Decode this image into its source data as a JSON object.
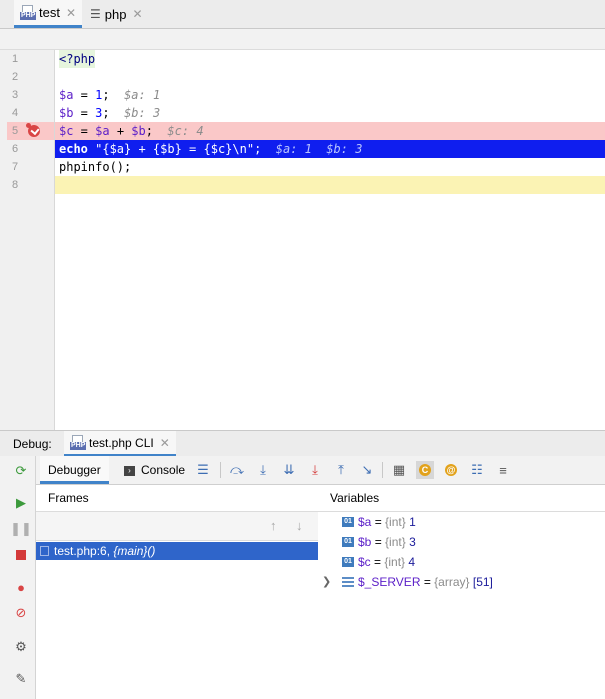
{
  "editor_tabs": [
    {
      "label": "test",
      "active": true
    },
    {
      "label": "php",
      "active": false
    }
  ],
  "code_lines": [
    {
      "n": "1"
    },
    {
      "n": "2"
    },
    {
      "n": "3"
    },
    {
      "n": "4"
    },
    {
      "n": "5"
    },
    {
      "n": "6"
    },
    {
      "n": "7"
    },
    {
      "n": "8"
    }
  ],
  "code": {
    "l1": "<?php",
    "l3_var": "$a",
    "l3_op": " = ",
    "l3_num": "1",
    "l3_semi": ";",
    "l3_hint": "$a: 1",
    "l4_var": "$b",
    "l4_op": " = ",
    "l4_num": "3",
    "l4_semi": ";",
    "l4_hint": "$b: 3",
    "l5_var1": "$c",
    "l5_op1": " = ",
    "l5_var2": "$a",
    "l5_op2": " + ",
    "l5_var3": "$b",
    "l5_semi": ";",
    "l5_hint": "$c: 4",
    "l6_kw": "echo",
    "l6_str": " \"{$a} + {$b} = {$c}\\n\";",
    "l6_hint1": "$a: 1",
    "l6_hint2": "$b: 3",
    "l7": "phpinfo();"
  },
  "debug": {
    "label": "Debug:",
    "session_tab": "test.php CLI",
    "subtabs": {
      "debugger": "Debugger",
      "console": "Console"
    },
    "frames_title": "Frames",
    "frame": {
      "location": "test.php:6, ",
      "function": "{main}()"
    },
    "variables_title": "Variables",
    "variables": [
      {
        "name": "$a",
        "eq": " = ",
        "type": "{int}",
        "value": " 1",
        "icon": "01"
      },
      {
        "name": "$b",
        "eq": " = ",
        "type": "{int}",
        "value": " 3",
        "icon": "01"
      },
      {
        "name": "$c",
        "eq": " = ",
        "type": "{int}",
        "value": " 4",
        "icon": "01"
      },
      {
        "name": "$_SERVER",
        "eq": " = ",
        "type": "{array}",
        "value": " [51]",
        "icon": "array"
      }
    ]
  },
  "colors": {
    "breakpoint_line": "#fac8c8",
    "execution_line": "#0f1eef",
    "current_line": "#fbf3b4",
    "selection": "#2f65ca",
    "tab_underline": "#4083c9"
  }
}
